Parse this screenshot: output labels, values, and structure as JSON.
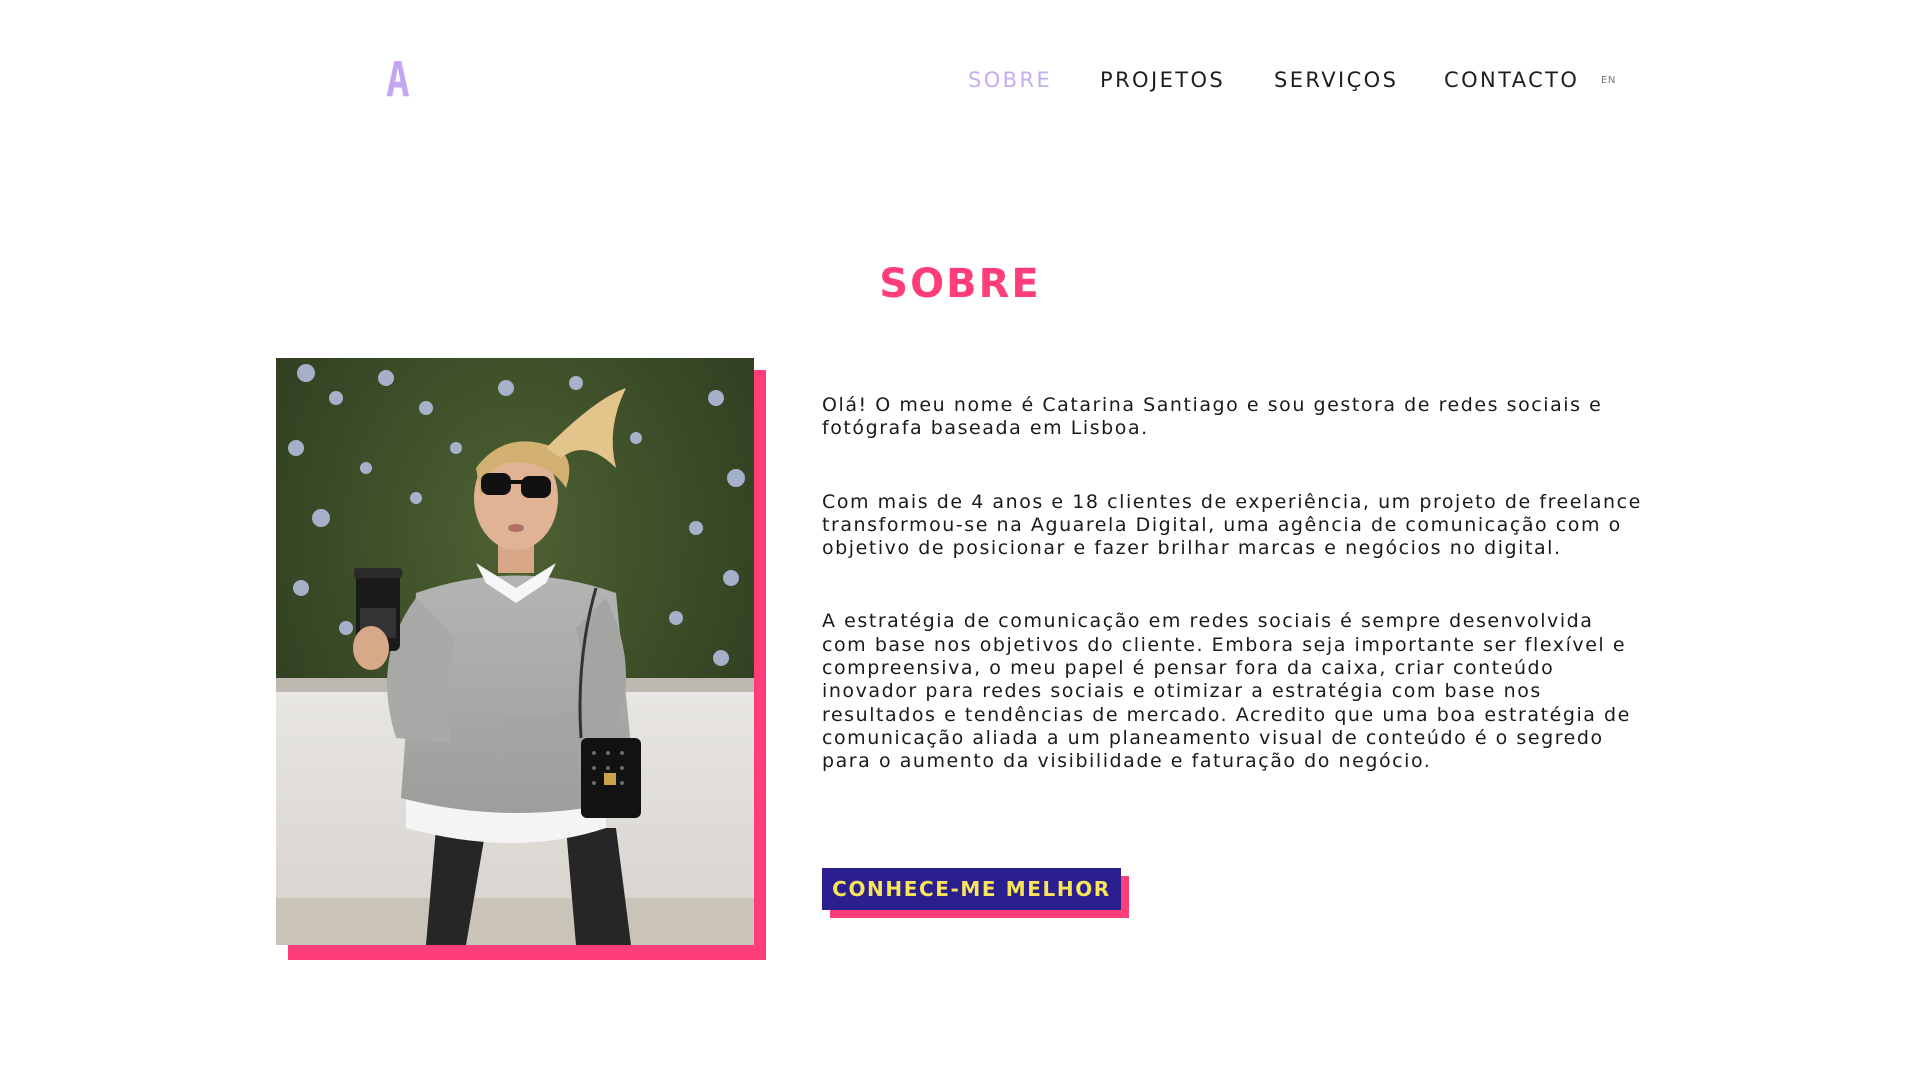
{
  "header": {
    "logo_letter": "A",
    "nav": {
      "sobre": "SOBRE",
      "projetos": "PROJETOS",
      "servicos": "SERVIÇOS",
      "contacto": "CONTACTO",
      "language": "EN"
    },
    "active_item": "SOBRE"
  },
  "main": {
    "title": "SOBRE",
    "photo": {
      "icon": "portrait-photo"
    },
    "paragraphs": [
      "Olá! O meu nome é Catarina Santiago e sou gestora de redes sociais e fotógrafa baseada em Lisboa.",
      "Com mais de 4 anos e 18 clientes de experiência, um projeto de freelance transformou-se na Aguarela Digital, uma agência de comunicação com o objetivo de posicionar e fazer brilhar marcas e negócios no digital.",
      "A estratégia de comunicação em redes sociais é sempre desenvolvida com base nos objetivos do cliente. Embora seja importante ser flexível e compreensiva, o meu papel é pensar fora da caixa, criar conteúdo inovador para redes sociais e otimizar a estratégia com base nos resultados e tendências de mercado. Acredito que uma boa estratégia de comunicação aliada a um planeamento visual de conteúdo é o segredo para o aumento da visibilidade e faturação do negócio."
    ],
    "cta_label": "CONHECE-ME MELHOR"
  },
  "colors": {
    "accent_pink": "#ff3e79",
    "nav_active": "#c3aef0",
    "logo": "#c4a6f2",
    "button_bg": "#2b1f8f",
    "button_text": "#f8e55a"
  }
}
